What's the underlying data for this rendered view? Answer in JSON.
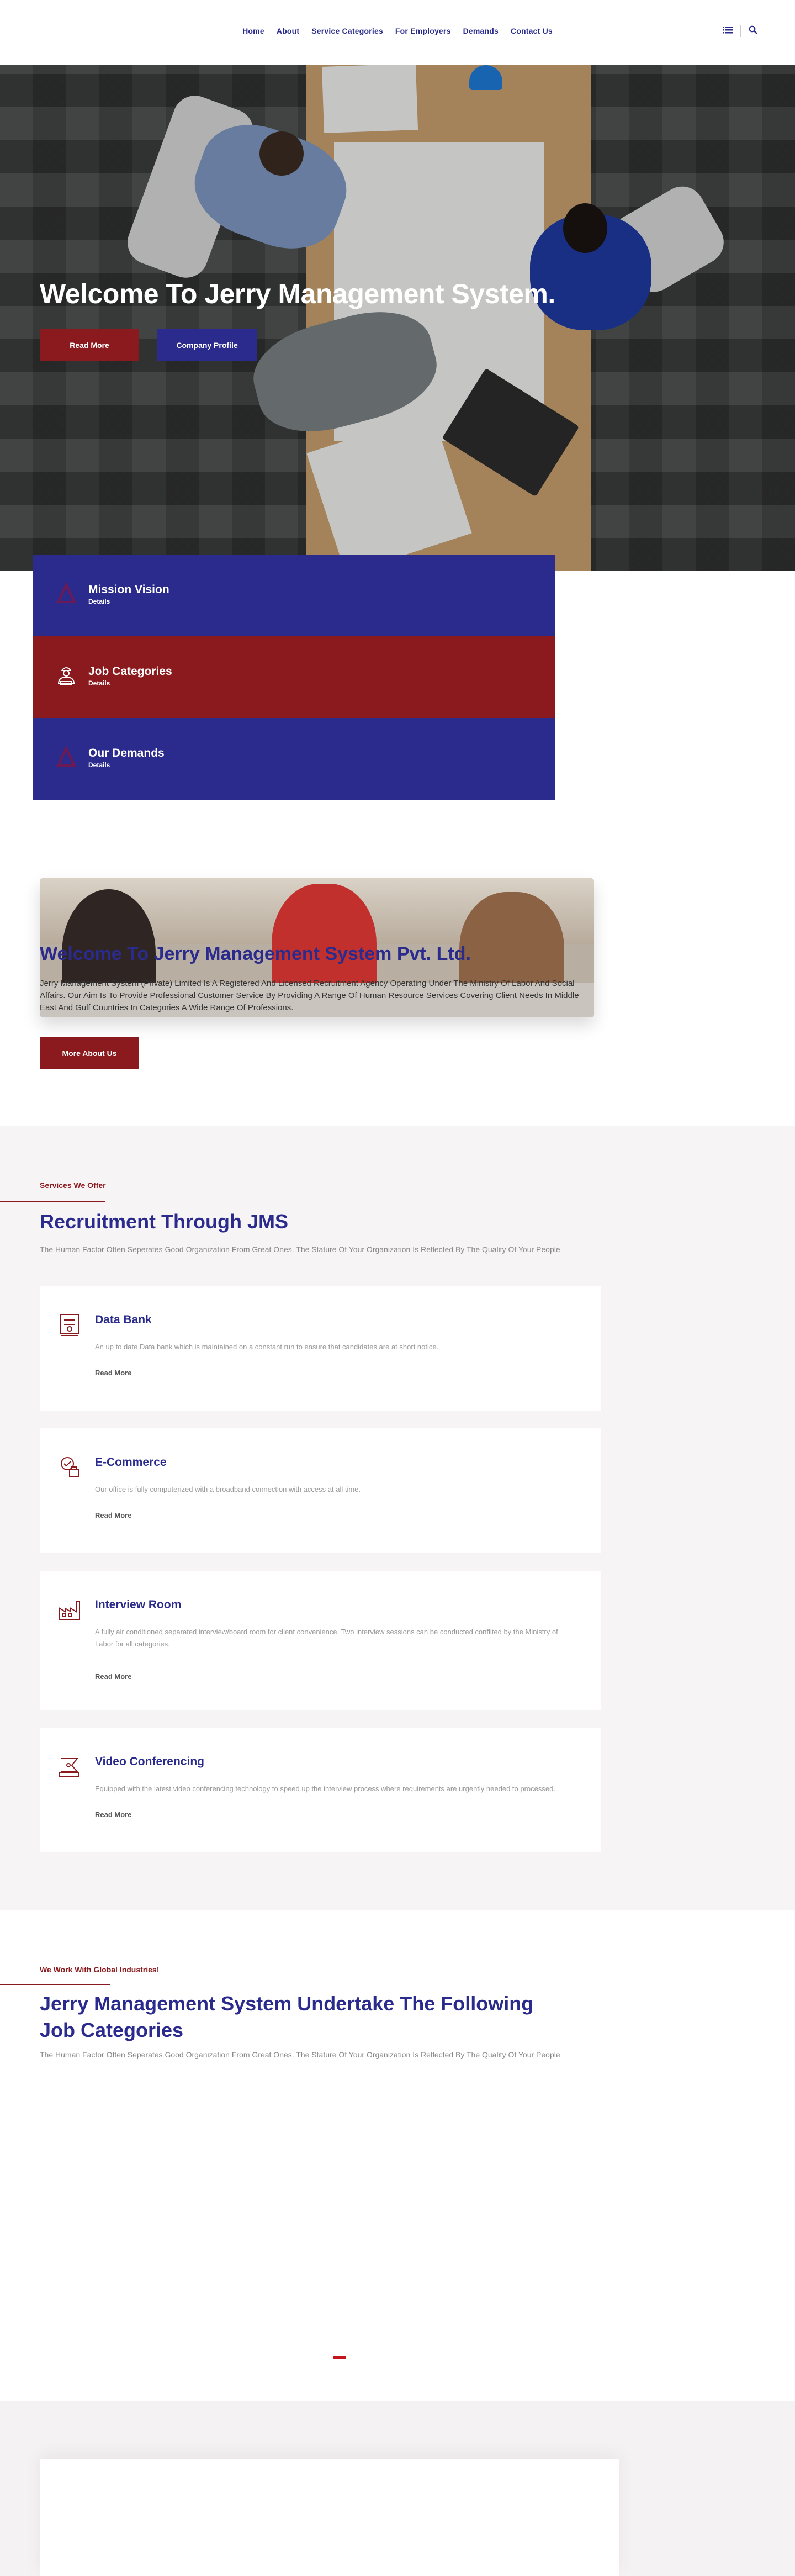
{
  "nav": {
    "items": [
      "Home",
      "About",
      "Service Categories",
      "For Employers",
      "Demands",
      "Contact Us"
    ],
    "list_icon": "list-icon",
    "search_icon": "search-icon"
  },
  "hero": {
    "title": "Welcome To Jerry Management System.",
    "btn_more": "Read More",
    "btn_profile": "Company Profile",
    "slides": 3,
    "active_slide": 1
  },
  "feature_cards": [
    {
      "title": "Mission Vision",
      "sub": "Details",
      "icon": "mission-icon",
      "color": "#2b2b8e"
    },
    {
      "title": "Job Categories",
      "sub": "Details",
      "icon": "worker-icon",
      "color": "#8b1a1e"
    },
    {
      "title": "Our Demands",
      "sub": "Details",
      "icon": "demands-icon",
      "color": "#2b2b8e"
    }
  ],
  "about": {
    "title": "Welcome To Jerry Management System Pvt. Ltd.",
    "text": "Jerry Management System (Private) Limited Is A Registered And Licensed Recruitment Agency Operating Under The Ministry Of Labor And Social Affairs. Our Aim Is To Provide Professional Customer Service By Providing A Range Of Human Resource Services Covering Client Needs In Middle East And Gulf Countries In Categories A Wide Range Of Professions.",
    "button": "More About Us"
  },
  "services": {
    "tag": "Services We Offer",
    "title": "Recruitment Through JMS",
    "subtitle": "The Human Factor Often Seperates Good Organization From Great Ones. The Stature Of Your Organization Is Reflected By The Quality Of Your People",
    "items": [
      {
        "title": "Data Bank",
        "desc": "An up to date Data bank which is maintained on a constant run to ensure that candidates are at short notice.",
        "more": "Read More",
        "icon": "data-bank-icon"
      },
      {
        "title": "E-Commerce",
        "desc": "Our office is fully computerized with a broadband connection with access at all time.",
        "more": "Read More",
        "icon": "ecommerce-icon"
      },
      {
        "title": "Interview Room",
        "desc": "A fully air conditioned separated interview/board room for client convenience. Two interview sessions can be conducted conflited by the Ministry of Labor for all categories.",
        "more": "Read More",
        "icon": "factory-icon"
      },
      {
        "title": "Video Conferencing",
        "desc": "Equipped with the latest video conferencing technology to speed up the interview process where requirements are urgently needed to processed.",
        "more": "Read More",
        "icon": "video-icon"
      }
    ]
  },
  "jobs": {
    "tag": "We Work With Global Industries!",
    "title": "Jerry Management System Undertake The Following Job Categories",
    "subtitle": "The Human Factor Often Seperates Good Organization From Great Ones. The Stature Of Your Organization Is Reflected By The Quality Of Your People"
  },
  "colors": {
    "blue": "#2b2b8e",
    "red": "#8b1a1e"
  }
}
